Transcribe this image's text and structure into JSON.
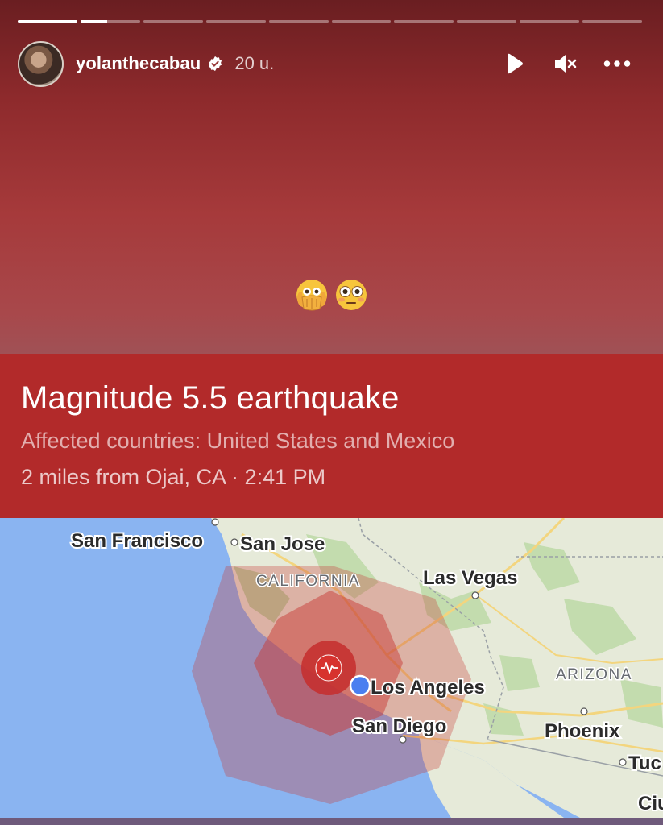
{
  "story": {
    "segments_total": 10,
    "segments_completed": 1,
    "current_segment_progress": 0.45
  },
  "header": {
    "username": "yolanthecabau",
    "verified": true,
    "time_ago": "20 u.",
    "icons": [
      "play-icon",
      "mute-icon",
      "more-icon"
    ]
  },
  "emojis": [
    "face-with-hand-over-mouth-eyes",
    "flushed-face"
  ],
  "alert": {
    "title": "Magnitude 5.5 earthquake",
    "affected": "Affected countries: United States and Mexico",
    "location": "2 miles from Ojai, CA · 2:41 PM",
    "color": "#b22a2a"
  },
  "map": {
    "labels": {
      "san_francisco": "San Francisco",
      "san_jose": "San Jose",
      "california": "CALIFORNIA",
      "las_vegas": "Las Vegas",
      "arizona": "ARIZONA",
      "los_angeles": "Los Angeles",
      "san_diego": "San Diego",
      "phoenix": "Phoenix",
      "tucson": "Tuc",
      "ciudad": "Ciu"
    },
    "colors": {
      "ocean": "#8ab4f1",
      "land": "#e9ecde",
      "quake_zone": "#d4453e",
      "user_dot": "#4a7ff0"
    }
  }
}
